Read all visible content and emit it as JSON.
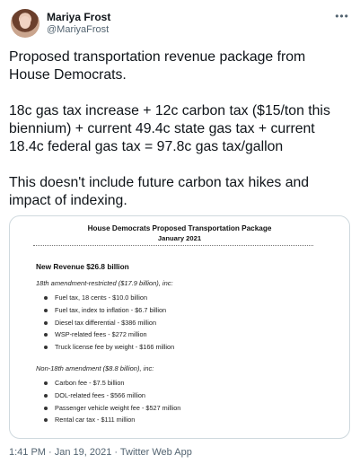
{
  "tweet": {
    "author_name": "Mariya Frost",
    "author_handle": "@MariyaFrost",
    "more_icon": "more-horizontal-icon",
    "paragraphs": [
      "Proposed transportation revenue package from House Democrats.",
      "18c gas tax increase + 12c carbon tax ($15/ton this biennium) +  current 49.4c state gas tax + current 18.4c federal gas tax = 97.8c gas tax/gallon",
      "This doesn't include future carbon tax hikes and impact of indexing."
    ],
    "timestamp": "1:41 PM · Jan 19, 2021 · Twitter Web App"
  },
  "document": {
    "title": "House Democrats Proposed Transportation Package",
    "subtitle": "January 2021",
    "heading": "New Revenue $26.8 billion",
    "sections": [
      {
        "title": "18th amendment-restricted ($17.9 billion), inc:",
        "items": [
          "Fuel tax, 18 cents - $10.0 billion",
          "Fuel tax, index to inflation - $6.7 billion",
          "Diesel tax differential - $386 million",
          "WSP-related fees - $272 million",
          "Truck license fee by weight - $166 million"
        ]
      },
      {
        "title": "Non-18th amendment ($8.8 billion), inc:",
        "items": [
          "Carbon fee - $7.5 billion",
          "DOL-related fees - $566 million",
          "Passenger vehicle weight fee - $527 million",
          "Rental car tax - $111 million"
        ]
      }
    ]
  },
  "colors": {
    "text": "#0f1419",
    "secondary": "#536471",
    "border": "#cfd9de"
  }
}
